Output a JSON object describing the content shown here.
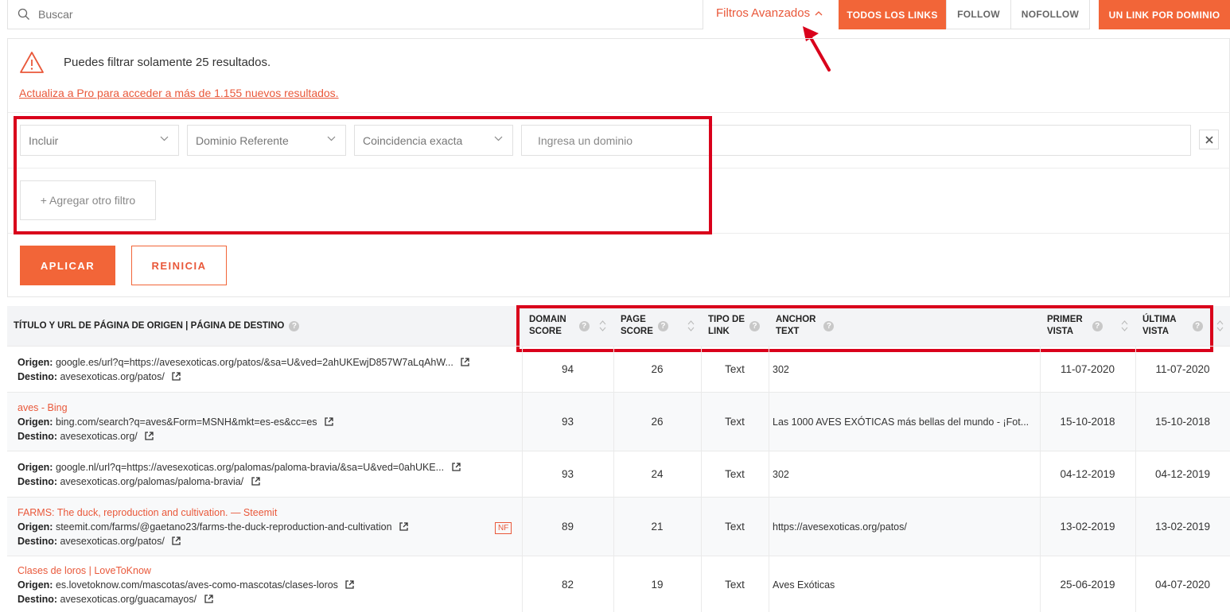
{
  "search": {
    "placeholder": "Buscar"
  },
  "advanced_filters_label": "Filtros Avanzados",
  "link_tabs": [
    "TODOS LOS LINKS",
    "FOLLOW",
    "NOFOLLOW"
  ],
  "one_link_button": "UN LINK POR DOMINIO",
  "notice": {
    "text": "Puedes filtrar solamente 25 resultados.",
    "upgrade_link": "Actualiza a Pro para acceder a más de 1.155 nuevos resultados."
  },
  "filter": {
    "include": "Incluir",
    "field": "Dominio Referente",
    "match": "Coincidencia exacta",
    "domain_placeholder": "Ingresa un dominio",
    "add_filter": "+ Agregar otro filtro"
  },
  "actions": {
    "apply": "APLICAR",
    "reset": "REINICIA"
  },
  "columns": {
    "source": "TÍTULO Y URL DE PÁGINA DE ORIGEN | PÁGINA DE DESTINO",
    "domain_score": [
      "DOMAIN",
      "SCORE"
    ],
    "page_score": [
      "PAGE",
      "SCORE"
    ],
    "link_type": [
      "TIPO DE",
      "LINK"
    ],
    "anchor": [
      "ANCHOR",
      "TEXT"
    ],
    "first_seen": [
      "PRIMER",
      "VISTA"
    ],
    "last_seen": [
      "ÚLTIMA",
      "VISTA"
    ]
  },
  "labels": {
    "origin": "Origen:",
    "dest": "Destino:"
  },
  "rows": [
    {
      "title": "",
      "origin": "google.es/url?q=https://avesexoticas.org/patos/&sa=U&ved=2ahUKEwjD857W7aLqAhW...",
      "dest": "avesexoticas.org/patos/",
      "nf": "",
      "domain_score": "94",
      "page_score": "26",
      "type": "Text",
      "anchor": "302",
      "first": "11-07-2020",
      "last": "11-07-2020"
    },
    {
      "title": "aves - Bing",
      "origin": "bing.com/search?q=aves&Form=MSNH&mkt=es-es&cc=es",
      "dest": "avesexoticas.org/",
      "nf": "",
      "domain_score": "93",
      "page_score": "26",
      "type": "Text",
      "anchor": "Las 1000 AVES EXÓTICAS más bellas del mundo - ¡Fot...",
      "first": "15-10-2018",
      "last": "15-10-2018"
    },
    {
      "title": "",
      "origin": "google.nl/url?q=https://avesexoticas.org/palomas/paloma-bravia/&sa=U&ved=0ahUKE...",
      "dest": "avesexoticas.org/palomas/paloma-bravia/",
      "nf": "",
      "domain_score": "93",
      "page_score": "24",
      "type": "Text",
      "anchor": "302",
      "first": "04-12-2019",
      "last": "04-12-2019"
    },
    {
      "title": "FARMS: The duck, reproduction and cultivation. — Steemit",
      "origin": "steemit.com/farms/@gaetano23/farms-the-duck-reproduction-and-cultivation",
      "dest": "avesexoticas.org/patos/",
      "nf": "NF",
      "domain_score": "89",
      "page_score": "21",
      "type": "Text",
      "anchor": "https://avesexoticas.org/patos/",
      "first": "13-02-2019",
      "last": "13-02-2019"
    },
    {
      "title": "Clases de loros | LoveToKnow",
      "origin": "es.lovetoknow.com/mascotas/aves-como-mascotas/clases-loros",
      "dest": "avesexoticas.org/guacamayos/",
      "nf": "",
      "domain_score": "82",
      "page_score": "19",
      "type": "Text",
      "anchor": "Aves Exóticas",
      "first": "25-06-2019",
      "last": "04-07-2020"
    }
  ],
  "colors": {
    "accent": "#f26538",
    "highlight": "#d9001b"
  }
}
